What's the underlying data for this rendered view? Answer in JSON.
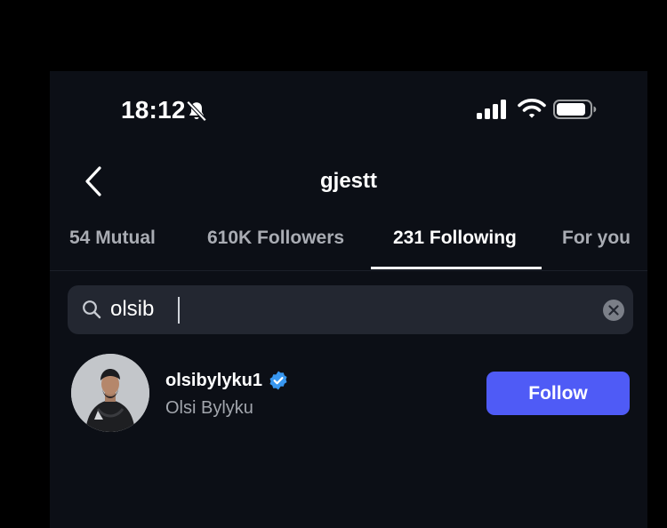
{
  "status_bar": {
    "time": "18:12",
    "icons": [
      "bell-off-icon",
      "cellular-signal-icon",
      "wifi-icon",
      "battery-icon"
    ]
  },
  "header": {
    "title": "gjestt",
    "back_icon": "chevron-left-icon"
  },
  "tabs": [
    {
      "label": "54 Mutual",
      "active": false
    },
    {
      "label": "610K Followers",
      "active": false
    },
    {
      "label": "231 Following",
      "active": true
    },
    {
      "label": "For you",
      "active": false
    }
  ],
  "search": {
    "value": "olsib",
    "icons": [
      "search-icon",
      "clear-icon"
    ]
  },
  "results": [
    {
      "username": "olsibylyku1",
      "full_name": "Olsi Bylyku",
      "verified": true,
      "action_label": "Follow"
    }
  ],
  "colors": {
    "background": "#0c0f16",
    "search_field": "#232731",
    "follow_button": "#4f5bf6",
    "verified_badge": "#3897f0",
    "secondary_text": "#a2a6ad"
  }
}
